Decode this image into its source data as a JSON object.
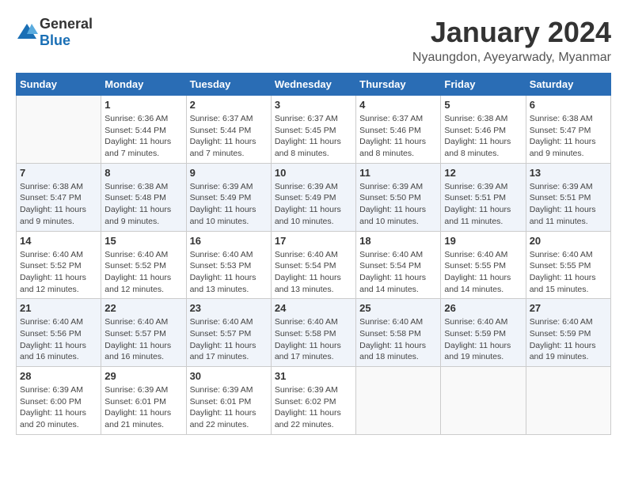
{
  "header": {
    "logo_general": "General",
    "logo_blue": "Blue",
    "month_title": "January 2024",
    "location": "Nyaungdon, Ayeyarwady, Myanmar"
  },
  "weekdays": [
    "Sunday",
    "Monday",
    "Tuesday",
    "Wednesday",
    "Thursday",
    "Friday",
    "Saturday"
  ],
  "weeks": [
    [
      {
        "day": "",
        "info": ""
      },
      {
        "day": "1",
        "info": "Sunrise: 6:36 AM\nSunset: 5:44 PM\nDaylight: 11 hours\nand 7 minutes."
      },
      {
        "day": "2",
        "info": "Sunrise: 6:37 AM\nSunset: 5:44 PM\nDaylight: 11 hours\nand 7 minutes."
      },
      {
        "day": "3",
        "info": "Sunrise: 6:37 AM\nSunset: 5:45 PM\nDaylight: 11 hours\nand 8 minutes."
      },
      {
        "day": "4",
        "info": "Sunrise: 6:37 AM\nSunset: 5:46 PM\nDaylight: 11 hours\nand 8 minutes."
      },
      {
        "day": "5",
        "info": "Sunrise: 6:38 AM\nSunset: 5:46 PM\nDaylight: 11 hours\nand 8 minutes."
      },
      {
        "day": "6",
        "info": "Sunrise: 6:38 AM\nSunset: 5:47 PM\nDaylight: 11 hours\nand 9 minutes."
      }
    ],
    [
      {
        "day": "7",
        "info": "Sunrise: 6:38 AM\nSunset: 5:47 PM\nDaylight: 11 hours\nand 9 minutes."
      },
      {
        "day": "8",
        "info": "Sunrise: 6:38 AM\nSunset: 5:48 PM\nDaylight: 11 hours\nand 9 minutes."
      },
      {
        "day": "9",
        "info": "Sunrise: 6:39 AM\nSunset: 5:49 PM\nDaylight: 11 hours\nand 10 minutes."
      },
      {
        "day": "10",
        "info": "Sunrise: 6:39 AM\nSunset: 5:49 PM\nDaylight: 11 hours\nand 10 minutes."
      },
      {
        "day": "11",
        "info": "Sunrise: 6:39 AM\nSunset: 5:50 PM\nDaylight: 11 hours\nand 10 minutes."
      },
      {
        "day": "12",
        "info": "Sunrise: 6:39 AM\nSunset: 5:51 PM\nDaylight: 11 hours\nand 11 minutes."
      },
      {
        "day": "13",
        "info": "Sunrise: 6:39 AM\nSunset: 5:51 PM\nDaylight: 11 hours\nand 11 minutes."
      }
    ],
    [
      {
        "day": "14",
        "info": "Sunrise: 6:40 AM\nSunset: 5:52 PM\nDaylight: 11 hours\nand 12 minutes."
      },
      {
        "day": "15",
        "info": "Sunrise: 6:40 AM\nSunset: 5:52 PM\nDaylight: 11 hours\nand 12 minutes."
      },
      {
        "day": "16",
        "info": "Sunrise: 6:40 AM\nSunset: 5:53 PM\nDaylight: 11 hours\nand 13 minutes."
      },
      {
        "day": "17",
        "info": "Sunrise: 6:40 AM\nSunset: 5:54 PM\nDaylight: 11 hours\nand 13 minutes."
      },
      {
        "day": "18",
        "info": "Sunrise: 6:40 AM\nSunset: 5:54 PM\nDaylight: 11 hours\nand 14 minutes."
      },
      {
        "day": "19",
        "info": "Sunrise: 6:40 AM\nSunset: 5:55 PM\nDaylight: 11 hours\nand 14 minutes."
      },
      {
        "day": "20",
        "info": "Sunrise: 6:40 AM\nSunset: 5:55 PM\nDaylight: 11 hours\nand 15 minutes."
      }
    ],
    [
      {
        "day": "21",
        "info": "Sunrise: 6:40 AM\nSunset: 5:56 PM\nDaylight: 11 hours\nand 16 minutes."
      },
      {
        "day": "22",
        "info": "Sunrise: 6:40 AM\nSunset: 5:57 PM\nDaylight: 11 hours\nand 16 minutes."
      },
      {
        "day": "23",
        "info": "Sunrise: 6:40 AM\nSunset: 5:57 PM\nDaylight: 11 hours\nand 17 minutes."
      },
      {
        "day": "24",
        "info": "Sunrise: 6:40 AM\nSunset: 5:58 PM\nDaylight: 11 hours\nand 17 minutes."
      },
      {
        "day": "25",
        "info": "Sunrise: 6:40 AM\nSunset: 5:58 PM\nDaylight: 11 hours\nand 18 minutes."
      },
      {
        "day": "26",
        "info": "Sunrise: 6:40 AM\nSunset: 5:59 PM\nDaylight: 11 hours\nand 19 minutes."
      },
      {
        "day": "27",
        "info": "Sunrise: 6:40 AM\nSunset: 5:59 PM\nDaylight: 11 hours\nand 19 minutes."
      }
    ],
    [
      {
        "day": "28",
        "info": "Sunrise: 6:39 AM\nSunset: 6:00 PM\nDaylight: 11 hours\nand 20 minutes."
      },
      {
        "day": "29",
        "info": "Sunrise: 6:39 AM\nSunset: 6:01 PM\nDaylight: 11 hours\nand 21 minutes."
      },
      {
        "day": "30",
        "info": "Sunrise: 6:39 AM\nSunset: 6:01 PM\nDaylight: 11 hours\nand 22 minutes."
      },
      {
        "day": "31",
        "info": "Sunrise: 6:39 AM\nSunset: 6:02 PM\nDaylight: 11 hours\nand 22 minutes."
      },
      {
        "day": "",
        "info": ""
      },
      {
        "day": "",
        "info": ""
      },
      {
        "day": "",
        "info": ""
      }
    ]
  ]
}
